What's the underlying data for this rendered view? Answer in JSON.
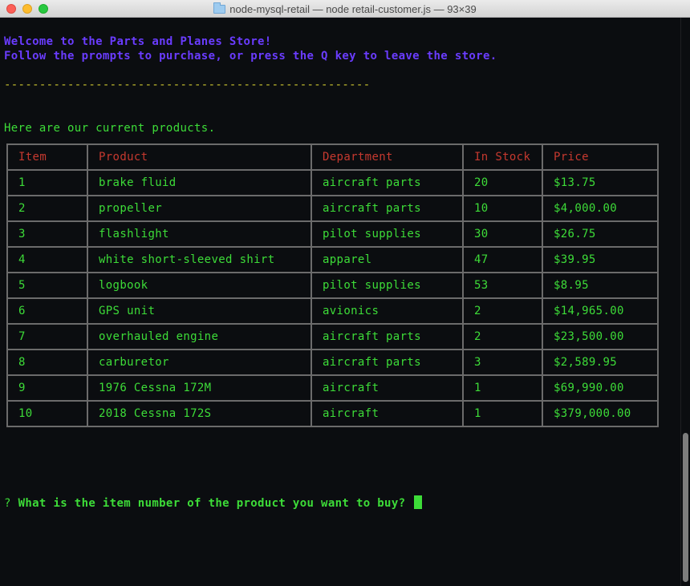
{
  "window": {
    "title": "node-mysql-retail — node retail-customer.js — 93×39"
  },
  "terminal": {
    "welcome": "Welcome to the Parts and Planes Store!",
    "instructions": "Follow the prompts to purchase, or press the Q key to leave the store.",
    "divider": "----------------------------------------------------",
    "products_intro": "Here are our current products.",
    "table": {
      "headers": [
        "Item",
        "Product",
        "Department",
        "In Stock",
        "Price"
      ],
      "rows": [
        [
          "1",
          "brake fluid",
          "aircraft parts",
          "20",
          "$13.75"
        ],
        [
          "2",
          "propeller",
          "aircraft parts",
          "10",
          "$4,000.00"
        ],
        [
          "3",
          "flashlight",
          "pilot supplies",
          "30",
          "$26.75"
        ],
        [
          "4",
          "white short-sleeved shirt",
          "apparel",
          "47",
          "$39.95"
        ],
        [
          "5",
          "logbook",
          "pilot supplies",
          "53",
          "$8.95"
        ],
        [
          "6",
          "GPS unit",
          "avionics",
          "2",
          "$14,965.00"
        ],
        [
          "7",
          "overhauled engine",
          "aircraft parts",
          "2",
          "$23,500.00"
        ],
        [
          "8",
          "carburetor",
          "aircraft parts",
          "3",
          "$2,589.95"
        ],
        [
          "9",
          "1976 Cessna 172M",
          "aircraft",
          "1",
          "$69,990.00"
        ],
        [
          "10",
          "2018 Cessna 172S",
          "aircraft",
          "1",
          "$379,000.00"
        ]
      ]
    },
    "prompt_mark": "?",
    "prompt_question": "What is the item number of the product you want to buy?"
  },
  "colors": {
    "background": "#0b0d10",
    "blue_text": "#6a3cff",
    "green_text": "#3ddc38",
    "yellow_divider": "#c8c42f",
    "header_red": "#c6392f"
  }
}
